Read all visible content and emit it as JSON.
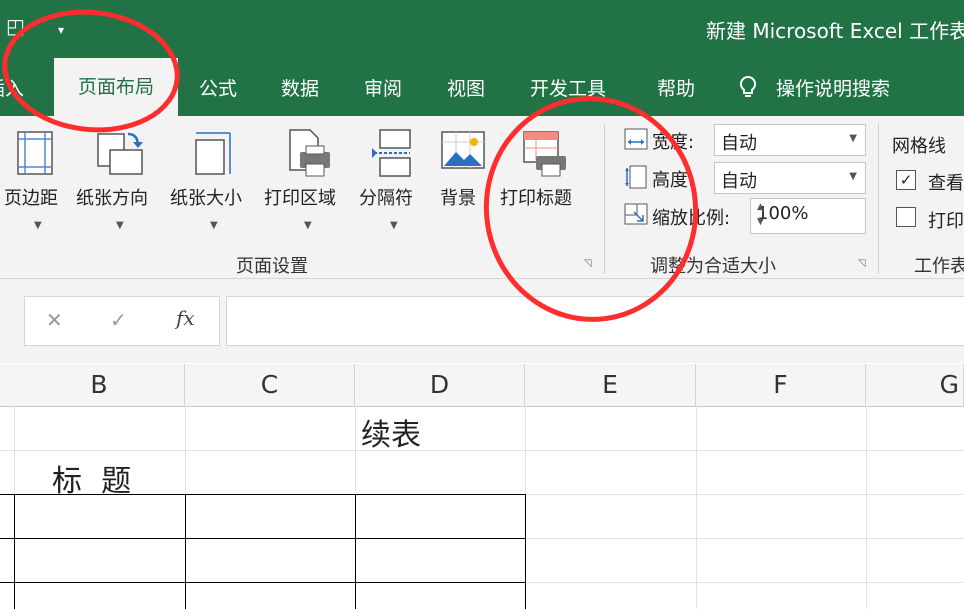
{
  "window": {
    "title": "新建 Microsoft Excel 工作表"
  },
  "tabs": [
    {
      "label": "插入"
    },
    {
      "label": "页面布局"
    },
    {
      "label": "公式"
    },
    {
      "label": "数据"
    },
    {
      "label": "审阅"
    },
    {
      "label": "视图"
    },
    {
      "label": "开发工具"
    },
    {
      "label": "帮助"
    }
  ],
  "search": {
    "label": "操作说明搜索",
    "icon": "lightbulb-icon"
  },
  "ribbon": {
    "page_setup": {
      "group_label": "页面设置",
      "buttons": [
        {
          "label": "页边距",
          "icon": "margins-icon"
        },
        {
          "label": "纸张方向",
          "icon": "orientation-icon"
        },
        {
          "label": "纸张大小",
          "icon": "paper-size-icon"
        },
        {
          "label": "打印区域",
          "icon": "print-area-icon"
        },
        {
          "label": "分隔符",
          "icon": "breaks-icon"
        },
        {
          "label": "背景",
          "icon": "background-icon"
        },
        {
          "label": "打印标题",
          "icon": "print-titles-icon"
        }
      ]
    },
    "scale_to_fit": {
      "group_label": "调整为合适大小",
      "width_label": "宽度:",
      "width_value": "自动",
      "height_label": "高度:",
      "height_value": "自动",
      "scale_label": "缩放比例:",
      "scale_value": "100%"
    },
    "sheet_options": {
      "group_label": "工作表",
      "gridlines_label": "网格线",
      "view_label": "查看",
      "view_checked": true,
      "print_label": "打印",
      "print_checked": false
    }
  },
  "formula_bar": {
    "cancel": "✕",
    "enter": "✓",
    "fx": "fx",
    "value": ""
  },
  "columns": [
    "B",
    "C",
    "D",
    "E",
    "F",
    "G"
  ],
  "cells": {
    "D1": "续表",
    "B2": "标  题"
  },
  "colors": {
    "excel_green": "#217346",
    "annotation_red": "#ff2d2d"
  }
}
